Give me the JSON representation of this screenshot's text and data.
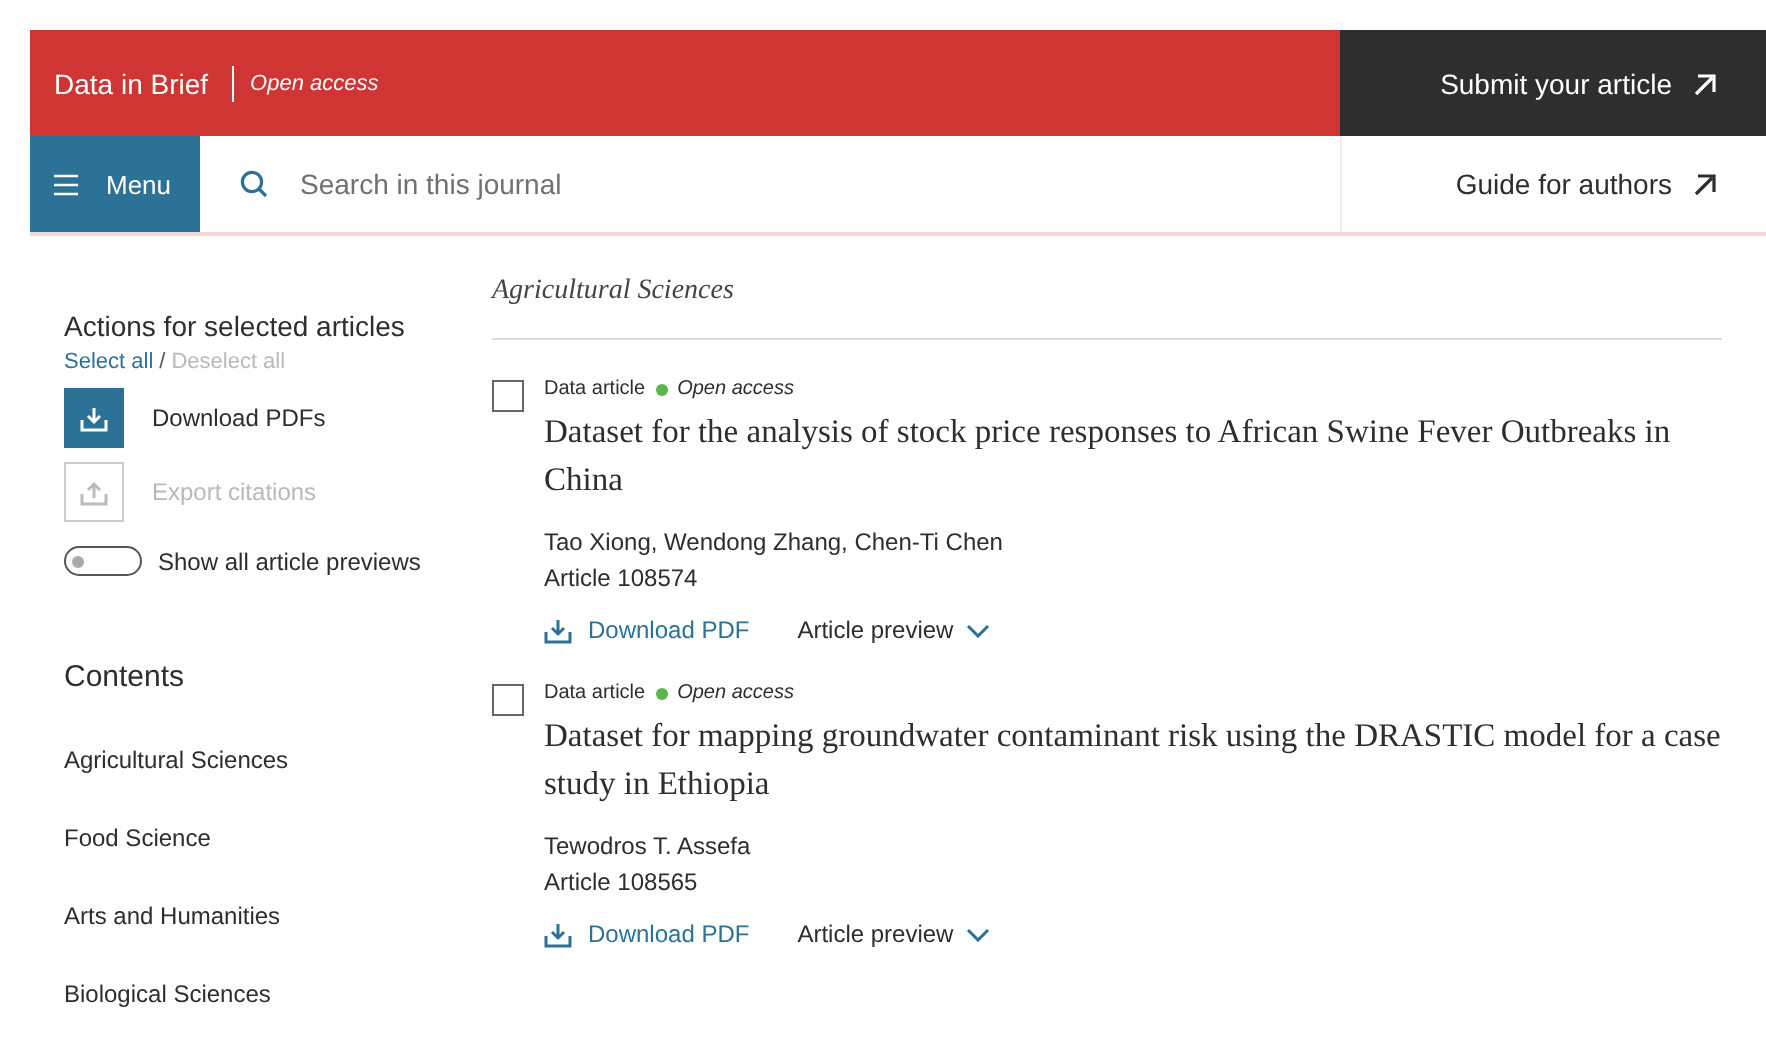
{
  "header": {
    "journal": "Data in Brief",
    "access": "Open access",
    "submit": "Submit your article"
  },
  "nav": {
    "menu": "Menu",
    "search": {
      "placeholder": "Search in this journal"
    },
    "guide": "Guide for authors"
  },
  "sidebar": {
    "actions_title": "Actions for selected articles",
    "select_all": "Select all",
    "separator": "/",
    "deselect_all": "Deselect all",
    "actions": [
      {
        "kind": "download",
        "label": "Download PDFs",
        "disabled": false
      },
      {
        "kind": "export",
        "label": "Export citations",
        "disabled": true
      }
    ],
    "preview_toggle": {
      "label": "Show all article previews",
      "on": false
    },
    "contents_title": "Contents",
    "contents": [
      "Agricultural Sciences",
      "Food Science",
      "Arts and Humanities",
      "Biological Sciences"
    ]
  },
  "section": "Agricultural Sciences",
  "articles": [
    {
      "type": "Data article",
      "access": "Open access",
      "checked": false,
      "title": "Dataset for the analysis of stock price responses to African Swine Fever Outbreaks in China",
      "authors": "Tao Xiong, Wendong Zhang, Chen-Ti Chen",
      "number": "Article 108574",
      "download": "Download PDF",
      "preview": "Article preview"
    },
    {
      "type": "Data article",
      "access": "Open access",
      "checked": false,
      "title": "Dataset for mapping groundwater contaminant risk using the DRASTIC model for a case study in Ethiopia",
      "authors": "Tewodros T. Assefa",
      "number": "Article 108565",
      "download": "Download PDF",
      "preview": "Article preview"
    }
  ]
}
